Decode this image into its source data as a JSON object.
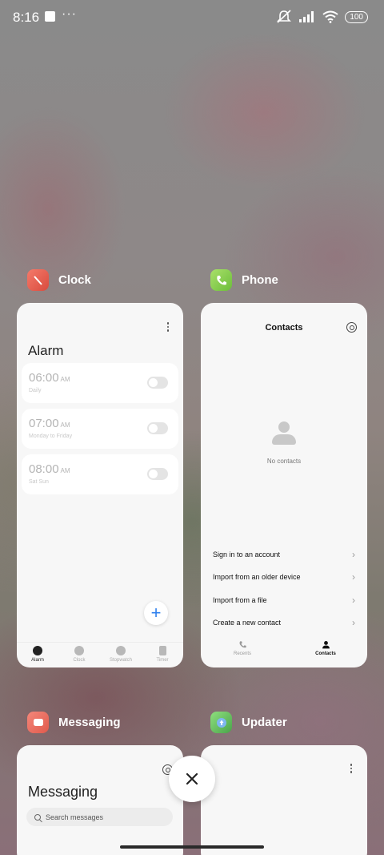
{
  "status_bar": {
    "time": "8:16",
    "battery": "100"
  },
  "apps": {
    "clock": {
      "name": "Clock",
      "heading": "Alarm",
      "alarms": [
        {
          "time": "06:00",
          "ampm": "AM",
          "repeat": "Daily",
          "enabled": false
        },
        {
          "time": "07:00",
          "ampm": "AM",
          "repeat": "Monday to Friday",
          "enabled": false
        },
        {
          "time": "08:00",
          "ampm": "AM",
          "repeat": "Sat Sun",
          "enabled": false
        }
      ],
      "tabs": [
        "Alarm",
        "Clock",
        "Stopwatch",
        "Timer"
      ]
    },
    "phone": {
      "name": "Phone",
      "title": "Contacts",
      "empty_text": "No contacts",
      "menu": [
        "Sign in to an account",
        "Import from an older device",
        "Import from a file",
        "Create a new contact"
      ],
      "tabs": [
        "Recents",
        "Contacts"
      ]
    },
    "messaging": {
      "name": "Messaging",
      "title": "Messaging",
      "search_placeholder": "Search messages"
    },
    "updater": {
      "name": "Updater"
    }
  },
  "colors": {
    "accent": "#2f80ed"
  }
}
